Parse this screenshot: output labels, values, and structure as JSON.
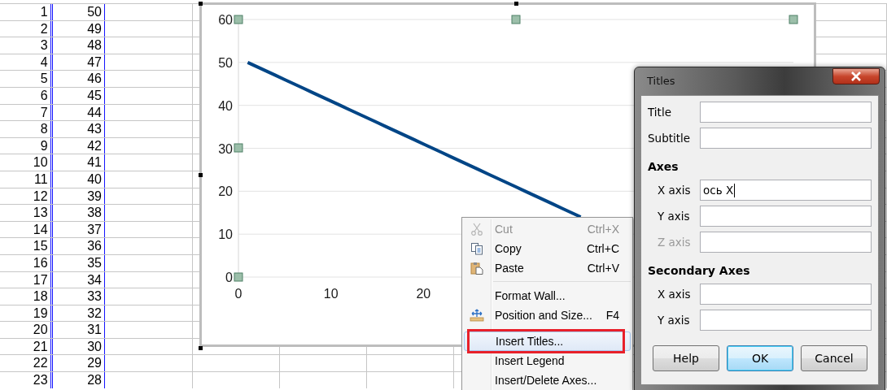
{
  "sheet": {
    "columns": [
      {
        "selected": true
      },
      {
        "selected": true
      }
    ],
    "rows": [
      [
        "1",
        "50"
      ],
      [
        "2",
        "49"
      ],
      [
        "3",
        "48"
      ],
      [
        "4",
        "47"
      ],
      [
        "5",
        "46"
      ],
      [
        "6",
        "45"
      ],
      [
        "7",
        "44"
      ],
      [
        "8",
        "43"
      ],
      [
        "9",
        "42"
      ],
      [
        "10",
        "41"
      ],
      [
        "11",
        "40"
      ],
      [
        "12",
        "39"
      ],
      [
        "13",
        "38"
      ],
      [
        "14",
        "37"
      ],
      [
        "15",
        "36"
      ],
      [
        "16",
        "35"
      ],
      [
        "17",
        "34"
      ],
      [
        "18",
        "33"
      ],
      [
        "19",
        "32"
      ],
      [
        "20",
        "31"
      ],
      [
        "21",
        "30"
      ],
      [
        "22",
        "29"
      ],
      [
        "23",
        "28"
      ]
    ]
  },
  "chart": {
    "chart_data": {
      "type": "line",
      "x": [
        1,
        2,
        3,
        4,
        5,
        6,
        7,
        8,
        9,
        10,
        11,
        12,
        13,
        14,
        15,
        16,
        17,
        18,
        19,
        20,
        21,
        22,
        23,
        24,
        25,
        26,
        27,
        28,
        29,
        30,
        31,
        32,
        33,
        34,
        35,
        36,
        37
      ],
      "series": [
        {
          "color": "#004586",
          "values": [
            50,
            49,
            48,
            47,
            46,
            45,
            44,
            43,
            42,
            41,
            40,
            39,
            38,
            37,
            36,
            35,
            34,
            33,
            32,
            31,
            30,
            29,
            28,
            27,
            26,
            25,
            24,
            23,
            22,
            21,
            20,
            19,
            18,
            17,
            16,
            15,
            14
          ]
        }
      ],
      "xlim": [
        0,
        60
      ],
      "ylim": [
        0,
        60
      ],
      "grid": true,
      "xticks": [
        {
          "value": 0,
          "label": "0"
        },
        {
          "value": 10,
          "label": "10"
        },
        {
          "value": 20,
          "label": "20"
        }
      ],
      "yticks": [
        {
          "value": 0,
          "label": "0"
        },
        {
          "value": 10,
          "label": "10"
        },
        {
          "value": 20,
          "label": "20"
        },
        {
          "value": 30,
          "label": "30"
        },
        {
          "value": 40,
          "label": "40"
        },
        {
          "value": 50,
          "label": "50"
        },
        {
          "value": 60,
          "label": "60"
        }
      ]
    }
  },
  "context_menu": {
    "items": [
      {
        "kind": "item",
        "label": "Cut",
        "shortcut": "Ctrl+X",
        "disabled": true,
        "selected": false,
        "annotated": false
      },
      {
        "kind": "item",
        "label": "Copy",
        "shortcut": "Ctrl+C",
        "disabled": false,
        "selected": false,
        "annotated": false
      },
      {
        "kind": "item",
        "label": "Paste",
        "shortcut": "Ctrl+V",
        "disabled": false,
        "selected": false,
        "annotated": false
      },
      {
        "kind": "separator"
      },
      {
        "kind": "item",
        "label": "Format Wall...",
        "disabled": false,
        "selected": false,
        "annotated": false
      },
      {
        "kind": "item",
        "label": "Position and Size...",
        "shortcut": "F4",
        "disabled": false,
        "selected": false,
        "annotated": false
      },
      {
        "kind": "item",
        "label": "Insert Titles...",
        "disabled": false,
        "selected": true,
        "annotated": true
      },
      {
        "kind": "item",
        "label": "Insert Legend",
        "disabled": false,
        "selected": false,
        "annotated": false
      },
      {
        "kind": "item",
        "label": "Insert/Delete Axes...",
        "disabled": false,
        "selected": false,
        "annotated": false
      }
    ]
  },
  "dialog": {
    "title": "Titles",
    "groups": [
      {
        "fields": [
          {
            "label": "Title",
            "disabled": false,
            "focused": false
          },
          {
            "label": "Subtitle",
            "disabled": false,
            "focused": false
          }
        ]
      },
      {
        "heading": "Axes",
        "fields": [
          {
            "label": "X axis",
            "value": "ось X",
            "disabled": false,
            "focused": true
          },
          {
            "label": "Y axis",
            "disabled": false,
            "focused": false
          },
          {
            "label": "Z axis",
            "disabled": true,
            "focused": false
          }
        ]
      },
      {
        "heading": "Secondary Axes",
        "fields": [
          {
            "label": "X axis",
            "disabled": false,
            "focused": false
          },
          {
            "label": "Y axis",
            "disabled": false,
            "focused": false
          }
        ]
      }
    ],
    "buttons": [
      {
        "label": "Help",
        "default": false
      },
      {
        "label": "OK",
        "default": true
      },
      {
        "label": "Cancel",
        "default": false
      }
    ]
  }
}
